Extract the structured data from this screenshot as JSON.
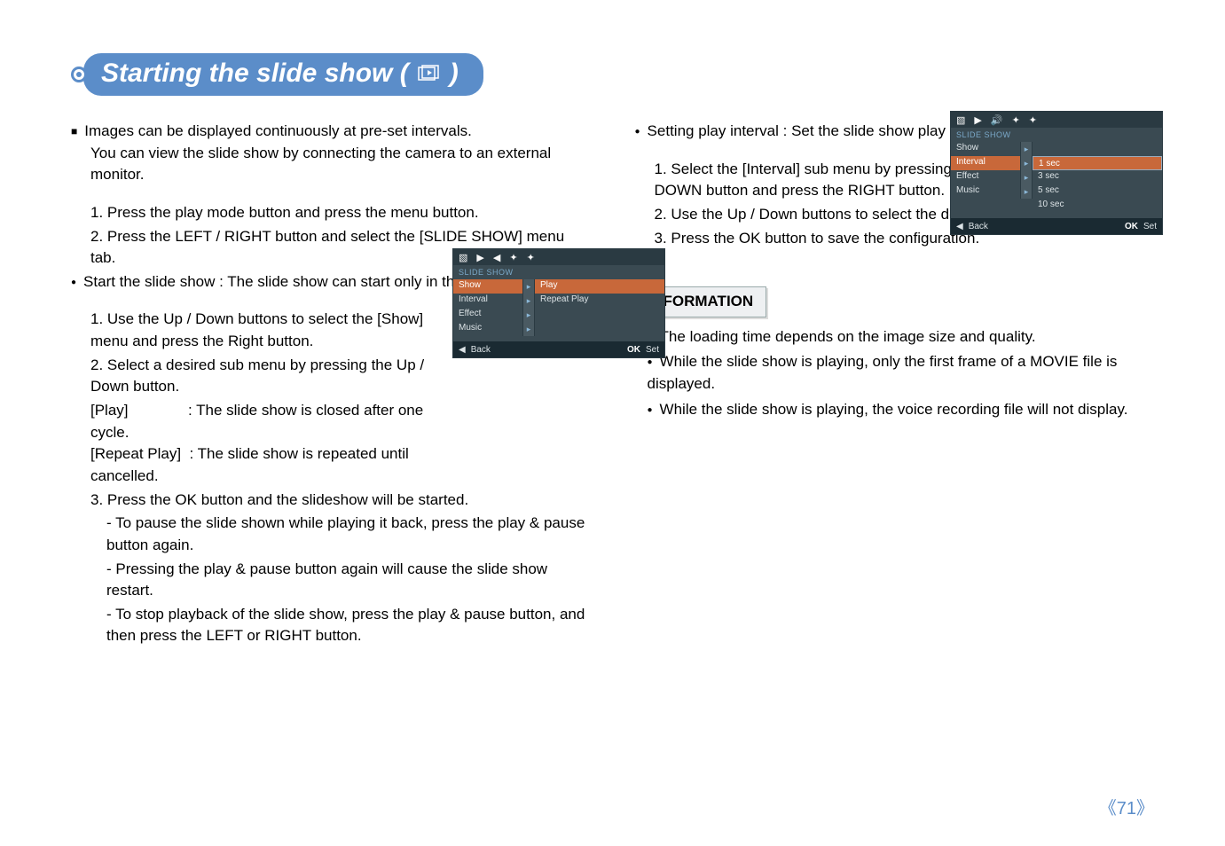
{
  "title": "Starting the slide show (",
  "title_end": ")",
  "left": {
    "intro1": "Images can be displayed continuously at pre-set intervals.",
    "intro2": "You can view the slide show by connecting the camera to an external monitor.",
    "s1": "1. Press the play mode button and press the menu button.",
    "s2": "2. Press the LEFT / RIGHT button and select the [SLIDE SHOW] menu tab.",
    "start_head": "Start the slide show : The slide show can start only in the [Show] menu.",
    "st1": "1. Use the Up / Down buttons to select the [Show] menu and press the Right button.",
    "st2": "2. Select a desired sub menu by pressing the Up / Down button.",
    "play_lbl": "[Play]",
    "play_txt": ": The slide show is closed after one cycle.",
    "repeat_lbl": "[Repeat Play]",
    "repeat_txt": ": The slide show is repeated until cancelled.",
    "st3": "3. Press the OK button and the slideshow will be started.",
    "st3a": "- To pause the slide shown while playing it back, press the play & pause button again.",
    "st3b": "- Pressing the play & pause button again will cause the slide show restart.",
    "st3c": "- To stop playback of the slide show, press the play & pause button, and then press the LEFT or RIGHT button."
  },
  "right": {
    "head": "Setting play interval : Set the slide show play interval.",
    "r1": "1. Select the [Interval] sub menu by pressing the UP / DOWN button and press the RIGHT button.",
    "r2": "2. Use the Up / Down buttons to select the desired interval.",
    "r3": "3. Press the OK button to save the configuration.",
    "info_title": "INFORMATION",
    "info1": "The loading time depends on the image size and quality.",
    "info2": "While the slide show is playing, only the first frame of a MOVIE file is displayed.",
    "info3": "While the slide show is playing, the voice recording file will not display."
  },
  "lcd1": {
    "title": "SLIDE SHOW",
    "rows": {
      "show": "Show",
      "interval": "Interval",
      "effect": "Effect",
      "music": "Music",
      "play": "Play",
      "repeat": "Repeat Play"
    },
    "back": "Back",
    "ok": "OK",
    "set": "Set"
  },
  "lcd2": {
    "title": "SLIDE SHOW",
    "rows": {
      "show": "Show",
      "interval": "Interval",
      "effect": "Effect",
      "music": "Music",
      "v1": "1 sec",
      "v3": "3 sec",
      "v5": "5 sec",
      "v10": "10 sec"
    },
    "back": "Back",
    "ok": "OK",
    "set": "Set"
  },
  "pagenum": "71"
}
